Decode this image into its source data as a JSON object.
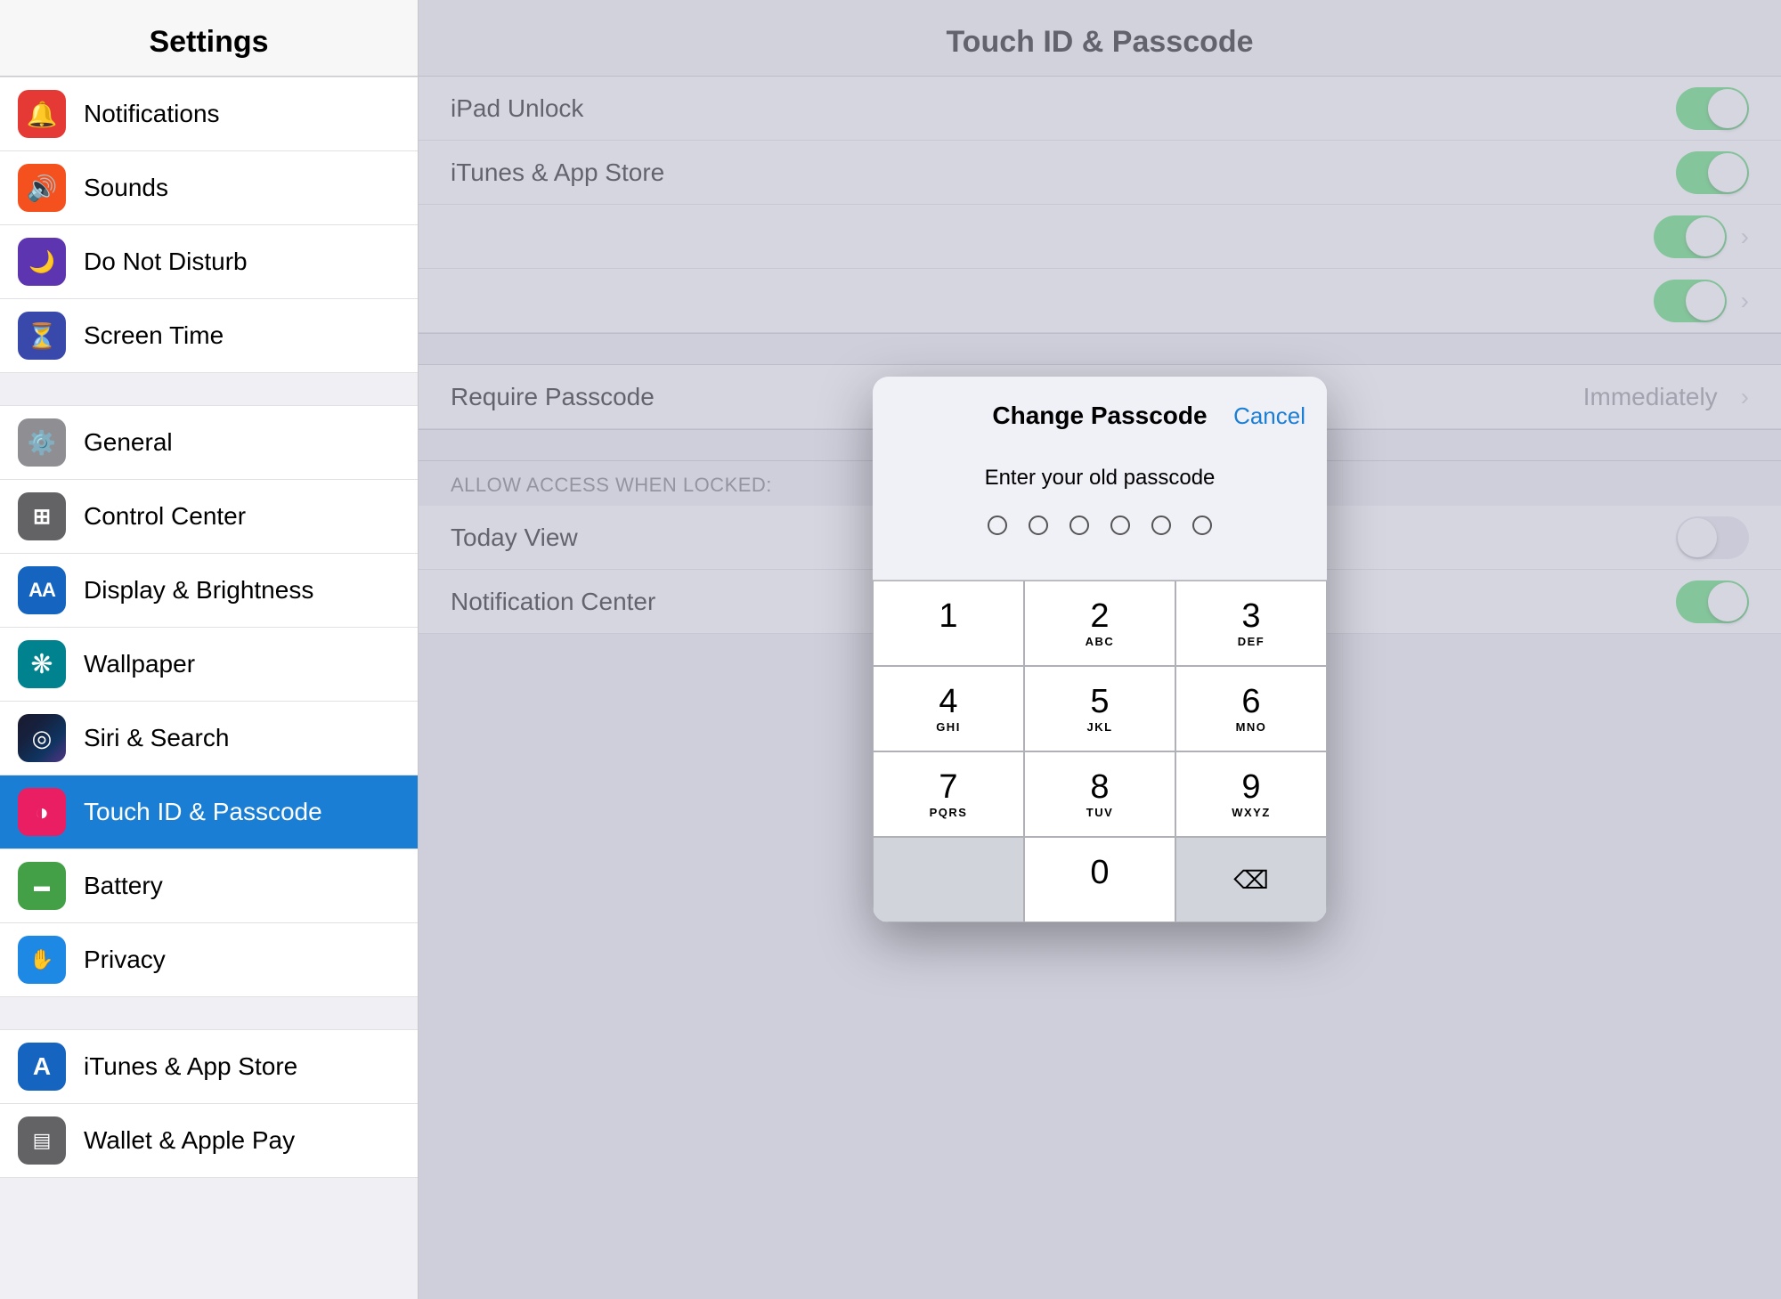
{
  "sidebar": {
    "title": "Settings",
    "items": [
      {
        "id": "notifications",
        "label": "Notifications",
        "icon": "🔔",
        "iconClass": "icon-red"
      },
      {
        "id": "sounds",
        "label": "Sounds",
        "icon": "🔊",
        "iconClass": "icon-orange-red"
      },
      {
        "id": "do-not-disturb",
        "label": "Do Not Disturb",
        "icon": "🌙",
        "iconClass": "icon-purple"
      },
      {
        "id": "screen-time",
        "label": "Screen Time",
        "icon": "⏳",
        "iconClass": "icon-indigo"
      },
      {
        "id": "general",
        "label": "General",
        "icon": "⚙️",
        "iconClass": "icon-gray"
      },
      {
        "id": "control-center",
        "label": "Control Center",
        "icon": "⊞",
        "iconClass": "icon-dark-gray"
      },
      {
        "id": "display-brightness",
        "label": "Display & Brightness",
        "icon": "AA",
        "iconClass": "icon-blue"
      },
      {
        "id": "wallpaper",
        "label": "Wallpaper",
        "icon": "❋",
        "iconClass": "icon-teal"
      },
      {
        "id": "siri-search",
        "label": "Siri & Search",
        "icon": "◎",
        "iconClass": "icon-dark-gray"
      },
      {
        "id": "touch-id-passcode",
        "label": "Touch ID & Passcode",
        "icon": "◑",
        "iconClass": "icon-pink",
        "active": true
      },
      {
        "id": "battery",
        "label": "Battery",
        "icon": "▬",
        "iconClass": "icon-green"
      },
      {
        "id": "privacy",
        "label": "Privacy",
        "icon": "✋",
        "iconClass": "icon-blue2"
      },
      {
        "id": "itunes-app-store",
        "label": "iTunes & App Store",
        "icon": "A",
        "iconClass": "icon-blue"
      },
      {
        "id": "wallet-apple-pay",
        "label": "Wallet & Apple Pay",
        "icon": "▤",
        "iconClass": "icon-dark-gray"
      }
    ]
  },
  "rightPanel": {
    "title": "Touch ID & Passcode",
    "rows": [
      {
        "id": "ipad-unlock",
        "label": "iPad Unlock",
        "toggle": true,
        "toggleOn": true
      },
      {
        "id": "itunes-app-store",
        "label": "iTunes & App Store",
        "toggle": true,
        "toggleOn": true
      },
      {
        "id": "row3",
        "label": "",
        "toggle": true,
        "toggleOn": true
      },
      {
        "id": "row4",
        "label": "",
        "toggle": true,
        "toggleOn": true
      }
    ],
    "requirePasscode": {
      "label": "Immediately",
      "hasChevron": true
    },
    "allowAccessSection": "ALLOW ACCESS WHEN LOCKED:",
    "allowAccessRows": [
      {
        "id": "today-view",
        "label": "Today View",
        "toggle": true,
        "toggleOn": false
      },
      {
        "id": "notification-center",
        "label": "Notification Center",
        "toggle": true,
        "toggleOn": true
      }
    ]
  },
  "modal": {
    "title": "Change Passcode",
    "cancelLabel": "Cancel",
    "prompt": "Enter your old passcode",
    "dots": 6,
    "keypad": [
      {
        "num": "1",
        "letters": ""
      },
      {
        "num": "2",
        "letters": "ABC"
      },
      {
        "num": "3",
        "letters": "DEF"
      },
      {
        "num": "4",
        "letters": "GHI"
      },
      {
        "num": "5",
        "letters": "JKL"
      },
      {
        "num": "6",
        "letters": "MNO"
      },
      {
        "num": "7",
        "letters": "PQRS"
      },
      {
        "num": "8",
        "letters": "TUV"
      },
      {
        "num": "9",
        "letters": "WXYZ"
      },
      {
        "num": "0",
        "letters": ""
      }
    ]
  }
}
